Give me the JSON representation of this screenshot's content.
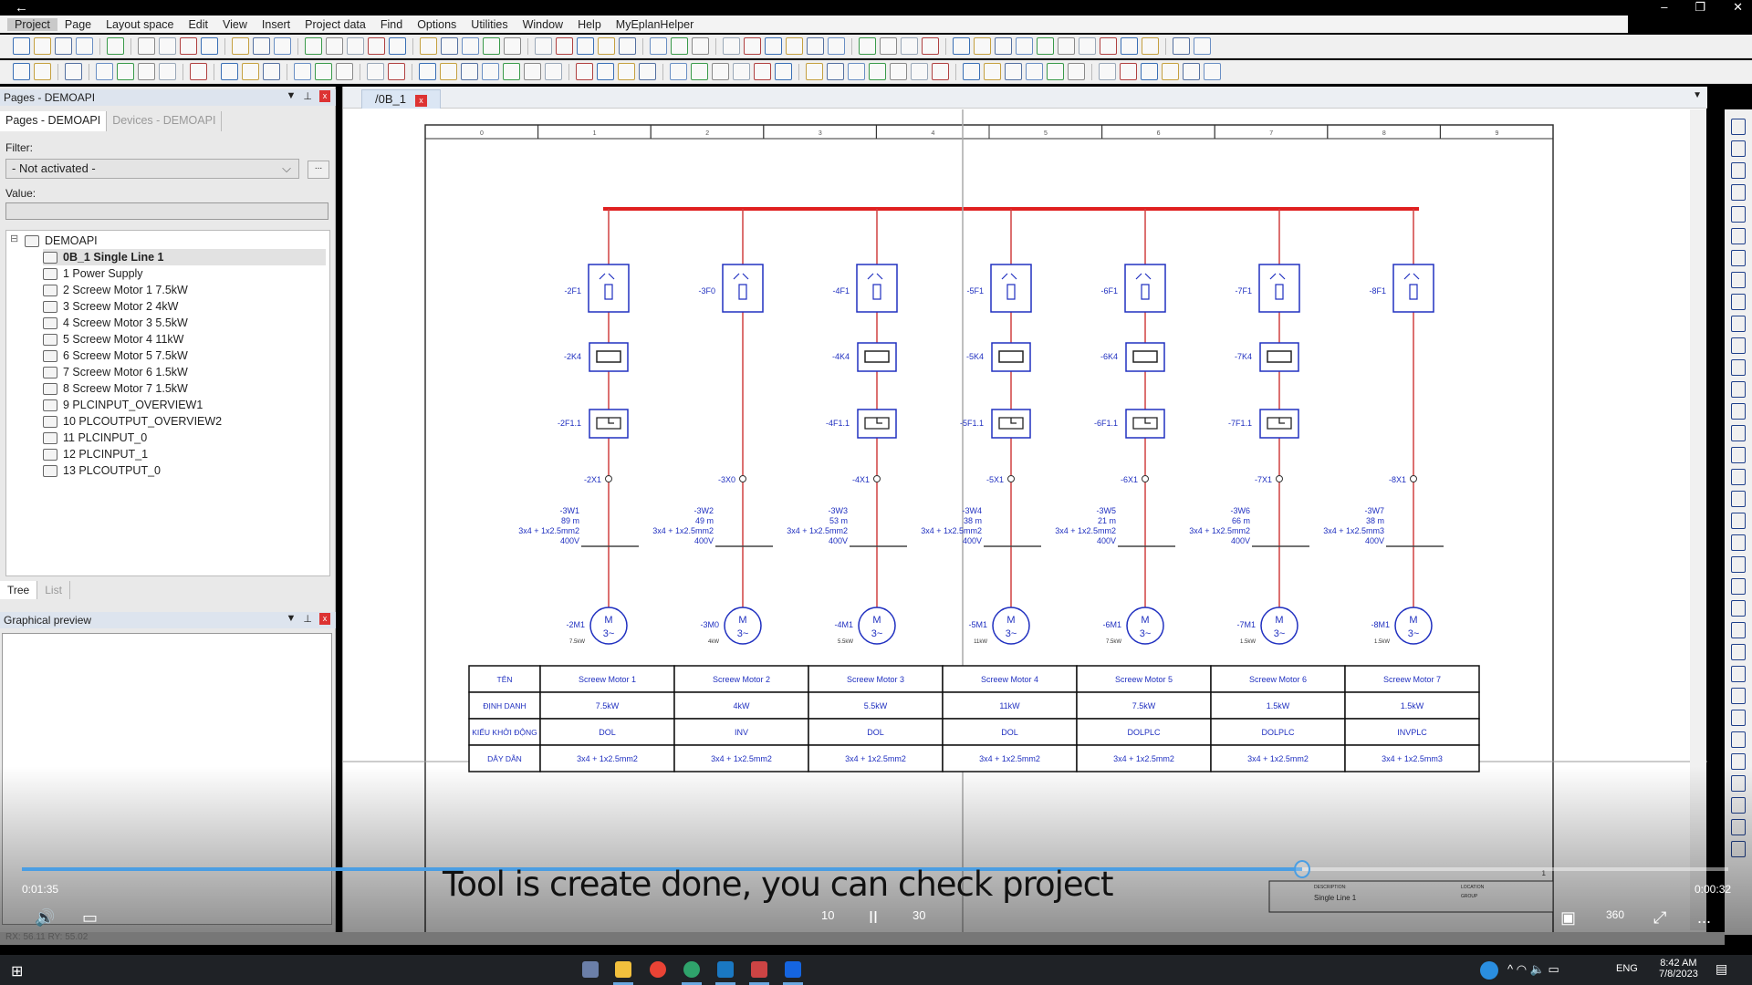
{
  "window": {
    "back": "←",
    "controls": [
      "–",
      "❐",
      "✕"
    ]
  },
  "menu": [
    "Project",
    "Page",
    "Layout space",
    "Edit",
    "View",
    "Insert",
    "Project data",
    "Find",
    "Options",
    "Utilities",
    "Window",
    "Help",
    "MyEplanHelper"
  ],
  "left_panel": {
    "title": "Pages - DEMOAPI",
    "tabs": [
      "Pages - DEMOAPI",
      "Devices - DEMOAPI"
    ],
    "filter_label": "Filter:",
    "filter_value": "- Not activated -",
    "filter_more": "...",
    "value_label": "Value:",
    "value": "",
    "tree_root": "DEMOAPI",
    "tree_items": [
      "0B_1 Single Line 1",
      "1 Power Supply",
      "2 Screew Motor 1 7.5kW",
      "3 Screew Motor 2 4kW",
      "4 Screew Motor 3 5.5kW",
      "5 Screew Motor 4 11kW",
      "6 Screew Motor 5 7.5kW",
      "7 Screew Motor 6 1.5kW",
      "8 Screew Motor 7 1.5kW",
      "9 PLCINPUT_OVERVIEW1",
      "10 PLCOUTPUT_OVERVIEW2",
      "11 PLCINPUT_0",
      "12 PLCINPUT_1",
      "13 PLCOUTPUT_0"
    ],
    "selected": "0B_1 Single Line 1",
    "bottom_tabs": [
      "Tree",
      "List"
    ],
    "preview_title": "Graphical preview"
  },
  "document": {
    "tab": "/0B_1",
    "tab_close": "x"
  },
  "schematic": {
    "colors": {
      "busbar": "#e02020",
      "wire": "#d04040",
      "symbol": "#2030c0",
      "label": "#2030c0"
    },
    "branches": [
      {
        "breaker": "-2F1",
        "contactor": "-2K4",
        "overload": "-2F1.1",
        "terminal": "-2X1",
        "cable": "-3W1",
        "length": "89 m",
        "section": "3x4 + 1x2.5mm2",
        "voltage": "400V",
        "motor": "-2M1",
        "power": "7.5kW"
      },
      {
        "breaker": "-3F0",
        "contactor": "",
        "overload": "",
        "terminal": "-3X0",
        "cable": "-3W2",
        "length": "49 m",
        "section": "3x4 + 1x2.5mm2",
        "voltage": "400V",
        "motor": "-3M0",
        "power": "4kW"
      },
      {
        "breaker": "-4F1",
        "contactor": "-4K4",
        "overload": "-4F1.1",
        "terminal": "-4X1",
        "cable": "-3W3",
        "length": "53 m",
        "section": "3x4 + 1x2.5mm2",
        "voltage": "400V",
        "motor": "-4M1",
        "power": "5.5kW"
      },
      {
        "breaker": "-5F1",
        "contactor": "-5K4",
        "overload": "-5F1.1",
        "terminal": "-5X1",
        "cable": "-3W4",
        "length": "38 m",
        "section": "3x4 + 1x2.5mm2",
        "voltage": "400V",
        "motor": "-5M1",
        "power": "11kW"
      },
      {
        "breaker": "-6F1",
        "contactor": "-6K4",
        "overload": "-6F1.1",
        "terminal": "-6X1",
        "cable": "-3W5",
        "length": "21 m",
        "section": "3x4 + 1x2.5mm2",
        "voltage": "400V",
        "motor": "-6M1",
        "power": "7.5kW"
      },
      {
        "breaker": "-7F1",
        "contactor": "-7K4",
        "overload": "-7F1.1",
        "terminal": "-7X1",
        "cable": "-3W6",
        "length": "66 m",
        "section": "3x4 + 1x2.5mm2",
        "voltage": "400V",
        "motor": "-7M1",
        "power": "1.5kW"
      },
      {
        "breaker": "-8F1",
        "contactor": "",
        "overload": "",
        "terminal": "-8X1",
        "cable": "-3W7",
        "length": "38 m",
        "section": "3x4 + 1x2.5mm3",
        "voltage": "400V",
        "motor": "-8M1",
        "power": "1.5kW"
      }
    ],
    "motor_text": [
      "M",
      "3~"
    ],
    "header_cols": [
      "0",
      "1",
      "2",
      "3",
      "4",
      "5",
      "6",
      "7",
      "8",
      "9"
    ],
    "table": {
      "rows": [
        {
          "head": "TÊN",
          "cells": [
            "Screew Motor 1",
            "Screew Motor 2",
            "Screew Motor 3",
            "Screew Motor 4",
            "Screew Motor 5",
            "Screew Motor 6",
            "Screew Motor 7"
          ]
        },
        {
          "head": "ĐỊNH DANH",
          "cells": [
            "7.5kW",
            "4kW",
            "5.5kW",
            "11kW",
            "7.5kW",
            "1.5kW",
            "1.5kW"
          ]
        },
        {
          "head": "KIỂU KHỞI ĐỘNG",
          "cells": [
            "DOL",
            "INV",
            "DOL",
            "DOL",
            "DOLPLC",
            "DOLPLC",
            "INVPLC"
          ]
        },
        {
          "head": "DÂY DẪN",
          "cells": [
            "3x4 + 1x2.5mm2",
            "3x4 + 1x2.5mm2",
            "3x4 + 1x2.5mm2",
            "3x4 + 1x2.5mm2",
            "3x4 + 1x2.5mm2",
            "3x4 + 1x2.5mm2",
            "3x4 + 1x2.5mm3"
          ]
        }
      ]
    },
    "title_block": {
      "description_label": "DESCRIPTION:",
      "description": "Single Line 1",
      "location": "LOCATION",
      "group": "GROUP",
      "page_no": "1"
    }
  },
  "video": {
    "elapsed": "0:01:35",
    "remaining": "0:00:32",
    "progress_percent": 75,
    "subtitle": "Tool is create done, you can check project",
    "controls": {
      "volume": "🔊",
      "captions": "▭",
      "rewind": "10",
      "pause": "II",
      "forward": "30",
      "miniplayer": "▣",
      "rotate": "360",
      "fullscreen": "⤢",
      "more": "..."
    }
  },
  "status_bar": {
    "left": "RX: 56.11  RY: 55.02"
  },
  "taskbar": {
    "time": "8:42 AM",
    "date": "7/8/2023",
    "language": "ENG"
  }
}
